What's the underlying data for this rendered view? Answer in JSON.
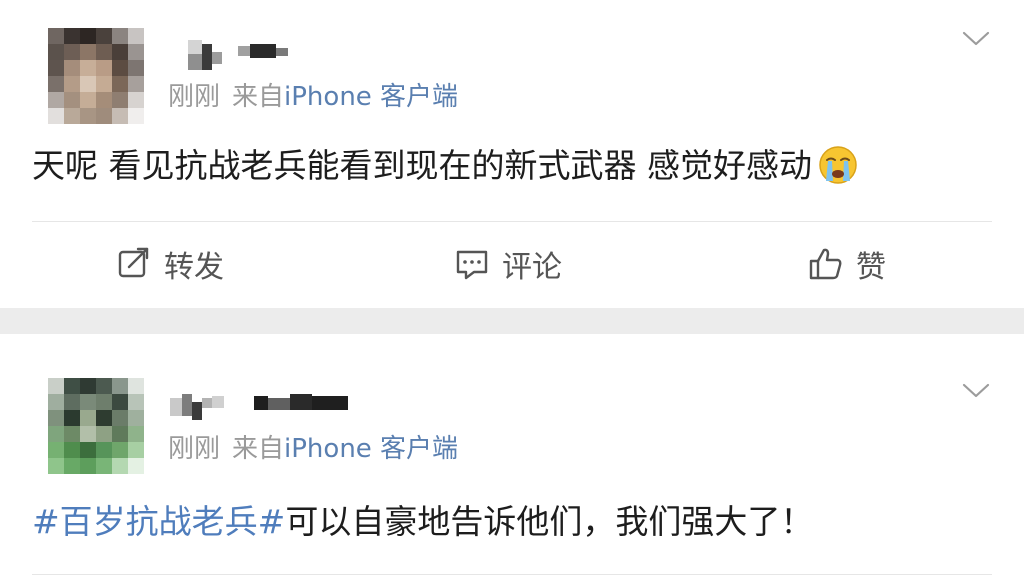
{
  "posts": [
    {
      "time": "刚刚",
      "source_prefix": "来自",
      "source": "iPhone 客户端",
      "content": "天呢 看见抗战老兵能看到现在的新式武器 感觉好感动",
      "emoji": "crying-face-icon",
      "actions": {
        "repost": "转发",
        "comment": "评论",
        "like": "赞"
      }
    },
    {
      "time": "刚刚",
      "source_prefix": "来自",
      "source": "iPhone 客户端",
      "topic": "#百岁抗战老兵#",
      "content": "可以自豪地告诉他们，我们强大了！"
    }
  ],
  "colors": {
    "link": "#5a7fb0",
    "topic": "#4f7dbc",
    "muted": "#9a9a9a",
    "separator": "#ececec"
  }
}
